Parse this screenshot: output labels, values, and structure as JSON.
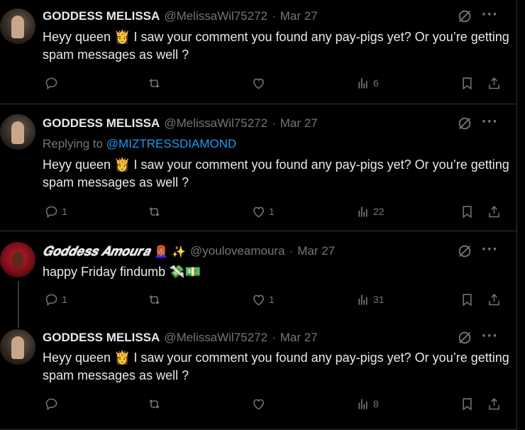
{
  "tweets": [
    {
      "author": "GODDESS MELISSA",
      "name_emoji": "",
      "handle": "@MelissaWil75272",
      "dot": "·",
      "date": "Mar 27",
      "replying_prefix": "",
      "replying_to": "",
      "text": "Heyy queen 👸 I saw your comment you found any pay-pigs yet? Or you’re getting spam messages as well ?",
      "replies": "",
      "likes": "",
      "views": "6"
    },
    {
      "author": "GODDESS MELISSA",
      "name_emoji": "",
      "handle": "@MelissaWil75272",
      "dot": "·",
      "date": "Mar 27",
      "replying_prefix": "Replying to",
      "replying_to": "@MIZTRESSDIAMOND",
      "text": "Heyy queen 👸 I saw your comment you found any pay-pigs yet? Or you’re getting spam messages as well ?",
      "replies": "1",
      "likes": "1",
      "views": "22"
    },
    {
      "author": "𝑮𝒐𝒅𝒅𝒆𝒔𝒔 𝑨𝒎𝒐𝒖𝒓𝒂",
      "name_emoji": "👩🏽‍🦰 ✨",
      "handle": "@youloveamoura",
      "dot": "·",
      "date": "Mar 27",
      "replying_prefix": "",
      "replying_to": "",
      "text": "happy Friday findumb 💸💵",
      "replies": "1",
      "likes": "1",
      "views": "31"
    },
    {
      "author": "GODDESS MELISSA",
      "name_emoji": "",
      "handle": "@MelissaWil75272",
      "dot": "·",
      "date": "Mar 27",
      "replying_prefix": "",
      "replying_to": "",
      "text": "Heyy queen 👸 I saw your comment you found any pay-pigs yet? Or you’re getting spam messages as well ?",
      "replies": "",
      "likes": "",
      "views": "8"
    }
  ],
  "more_glyph": "···",
  "colors": {
    "bg": "#000000",
    "text": "#e7e9ea",
    "muted": "#71767b",
    "link": "#1d9bf0",
    "border": "#2f3336"
  }
}
